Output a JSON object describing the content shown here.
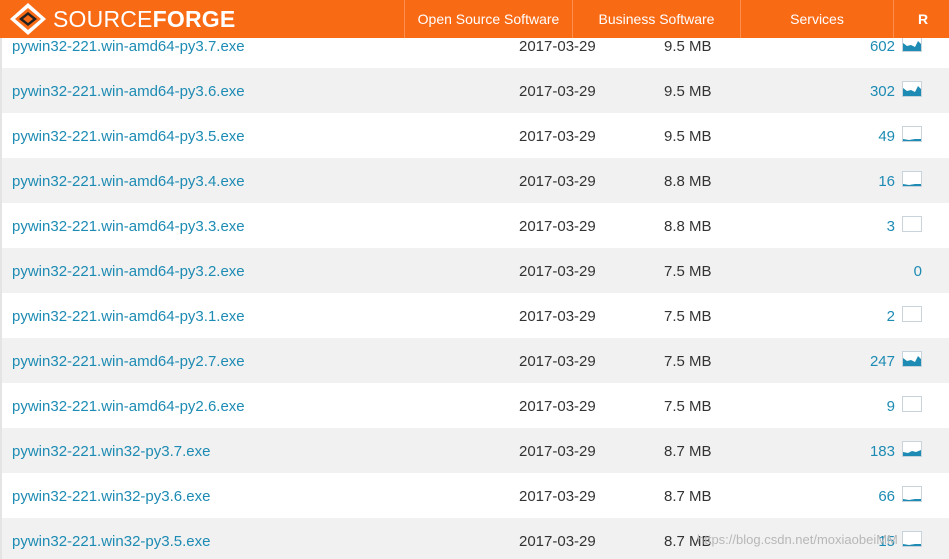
{
  "header": {
    "logo_thin": "SOURCE",
    "logo_bold": "FORGE",
    "nav": [
      "Open Source Software",
      "Business Software",
      "Services",
      "R"
    ]
  },
  "files": [
    {
      "name": "pywin32-221.win-amd64-py3.7.exe",
      "date": "2017-03-29",
      "size": "9.5 MB",
      "downloads": "602",
      "chart": "high"
    },
    {
      "name": "pywin32-221.win-amd64-py3.6.exe",
      "date": "2017-03-29",
      "size": "9.5 MB",
      "downloads": "302",
      "chart": "high"
    },
    {
      "name": "pywin32-221.win-amd64-py3.5.exe",
      "date": "2017-03-29",
      "size": "9.5 MB",
      "downloads": "49",
      "chart": "low"
    },
    {
      "name": "pywin32-221.win-amd64-py3.4.exe",
      "date": "2017-03-29",
      "size": "8.8 MB",
      "downloads": "16",
      "chart": "low"
    },
    {
      "name": "pywin32-221.win-amd64-py3.3.exe",
      "date": "2017-03-29",
      "size": "8.8 MB",
      "downloads": "3",
      "chart": "empty"
    },
    {
      "name": "pywin32-221.win-amd64-py3.2.exe",
      "date": "2017-03-29",
      "size": "7.5 MB",
      "downloads": "0",
      "chart": "none"
    },
    {
      "name": "pywin32-221.win-amd64-py3.1.exe",
      "date": "2017-03-29",
      "size": "7.5 MB",
      "downloads": "2",
      "chart": "empty"
    },
    {
      "name": "pywin32-221.win-amd64-py2.7.exe",
      "date": "2017-03-29",
      "size": "7.5 MB",
      "downloads": "247",
      "chart": "high"
    },
    {
      "name": "pywin32-221.win-amd64-py2.6.exe",
      "date": "2017-03-29",
      "size": "7.5 MB",
      "downloads": "9",
      "chart": "empty"
    },
    {
      "name": "pywin32-221.win32-py3.7.exe",
      "date": "2017-03-29",
      "size": "8.7 MB",
      "downloads": "183",
      "chart": "mid"
    },
    {
      "name": "pywin32-221.win32-py3.6.exe",
      "date": "2017-03-29",
      "size": "8.7 MB",
      "downloads": "66",
      "chart": "low"
    },
    {
      "name": "pywin32-221.win32-py3.5.exe",
      "date": "2017-03-29",
      "size": "8.7 MB",
      "downloads": "15",
      "chart": "low"
    }
  ],
  "watermark": "https://blog.csdn.net/moxiaobeiMM",
  "colors": {
    "brand": "#f96a15",
    "link": "#1d8bb3",
    "chart": "#1d8bb3"
  }
}
